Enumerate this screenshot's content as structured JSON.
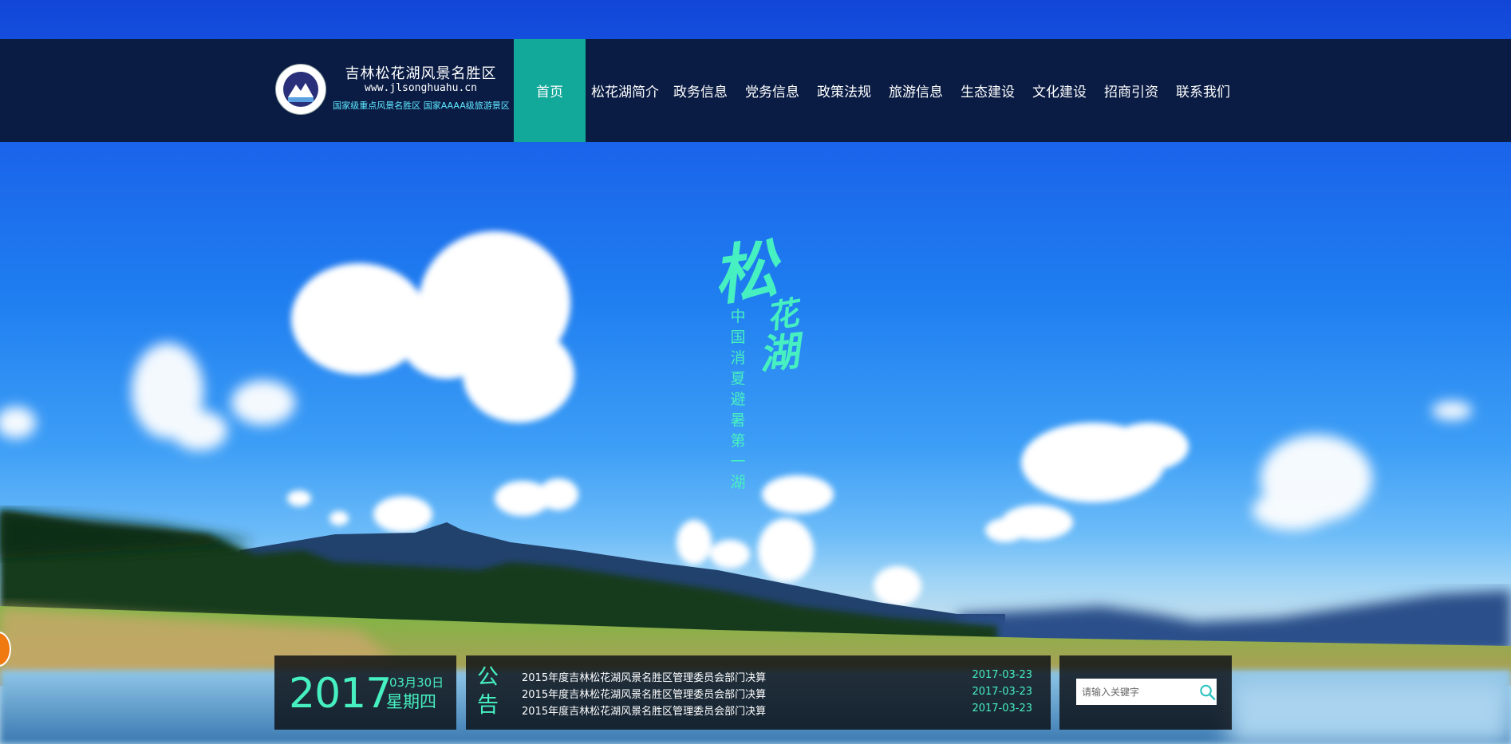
{
  "site": {
    "title": "吉林松花湖风景名胜区",
    "url": "www.jlsonghuahu.cn",
    "subtitle": "国家级重点风景名胜区 国家AAAA级旅游景区"
  },
  "nav": {
    "items": [
      {
        "label": "首页",
        "active": true
      },
      {
        "label": "松花湖简介"
      },
      {
        "label": "政务信息"
      },
      {
        "label": "党务信息"
      },
      {
        "label": "政策法规"
      },
      {
        "label": "旅游信息"
      },
      {
        "label": "生态建设"
      },
      {
        "label": "文化建设"
      },
      {
        "label": "招商引资"
      },
      {
        "label": "联系我们"
      }
    ]
  },
  "hero": {
    "calligraphy_main": "松",
    "calligraphy_2": "花",
    "calligraphy_3": "湖",
    "slogan": "中国消夏避暑第一湖"
  },
  "date": {
    "year": "2017",
    "month_day": "03月30日",
    "weekday": "星期四"
  },
  "notice": {
    "label": "公告",
    "items": [
      {
        "title": "2015年度吉林松花湖风景名胜区管理委员会部门决算",
        "date": "2017-03-23"
      },
      {
        "title": "2015年度吉林松花湖风景名胜区管理委员会部门决算",
        "date": "2017-03-23"
      },
      {
        "title": "2015年度吉林松花湖风景名胜区管理委员会部门决算",
        "date": "2017-03-23"
      }
    ]
  },
  "search": {
    "placeholder": "请输入关键字",
    "icon": "search-icon"
  },
  "colors": {
    "accent": "#46f0c0",
    "nav_active": "#12a89a",
    "header_bg": "#0a1c44"
  }
}
